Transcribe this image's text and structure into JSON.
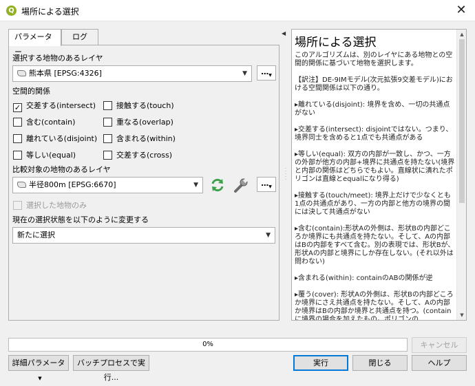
{
  "window": {
    "title": "場所による選択",
    "close_glyph": "✕",
    "app_icon_letter": "Q"
  },
  "tabs": [
    {
      "label": "パラメーター",
      "active": true
    },
    {
      "label": "ログ",
      "active": false
    }
  ],
  "form": {
    "source_label": "選択する地物のあるレイヤ",
    "source_value": "熊本県 [EPSG:4326]",
    "predicate_label": "空間的関係",
    "predicates": [
      {
        "label": "交差する(intersect)",
        "checked": true
      },
      {
        "label": "接触する(touch)",
        "checked": false
      },
      {
        "label": "含む(contain)",
        "checked": false
      },
      {
        "label": "重なる(overlap)",
        "checked": false
      },
      {
        "label": "離れている(disjoint)",
        "checked": false
      },
      {
        "label": "含まれる(within)",
        "checked": false
      },
      {
        "label": "等しい(equal)",
        "checked": false
      },
      {
        "label": "交差する(cross)",
        "checked": false
      }
    ],
    "compare_label": "比較対象の地物のあるレイヤ",
    "compare_value": "半径800m [EPSG:6670]",
    "selected_only_label": "選択した地物のみ",
    "selected_only_checked": false,
    "method_label": "現在の選択状態を以下のように変更する",
    "method_value": "新たに選択",
    "dots_label": "…"
  },
  "help": {
    "title": "場所による選択",
    "paragraphs": [
      "このアルゴリズムは、別のレイヤにある地物との空間的関係に基づいて地物を選択します。",
      "【訳注】DE-9IMモデル(次元拡張9交差モデル)における空間関係は以下の通り。",
      "▸離れている(disjoint): 境界を含め、一切の共通点がない",
      "▸交差する(intersect): disjointではない。つまり、境界同士を含めると1点でも共通点がある",
      "▸等しい(equal): 双方の内部が一致し、かつ、一方の外部が他方の内部+境界に共通点を持たない(境界と内部の関係はどちらでもよい。直線状に潰れたポリゴンは直線とequalになり得る)",
      "▸接触する(touch/meet): 境界上だけで少なくとも1点の共通点があり、一方の内部と他方の境界の間には決して共通点がない",
      "▸含む(contain):形状Aの外側は、形状Bの内部どころか境界にも共通点を持たない。そして、Aの内部はBの内部をすべて含む。別の表現では、形状Bが、形状Aの内部と境界にしか存在しない。(それ以外は問わない)",
      "▸含まれる(within): containのABの関係が逆",
      "▸覆う(cover): 形状Aの外側は、形状Bの内部どころか境界にさえ共通点を持たない。そして、Aの内部か境界はBの内部か境界と共通点を持つ。(containに境界の場合を加えたもの。ポリゴンの"
    ]
  },
  "progress": {
    "value": 0,
    "text": "0%",
    "color": "#06b025"
  },
  "buttons": {
    "cancel": "キャンセル",
    "advanced": "詳細パラメータ",
    "batch": "バッチプロセスで実行...",
    "run": "実行",
    "close": "閉じる",
    "help": "ヘルプ"
  },
  "colors": {
    "accent": "#0078d7",
    "qgis_green": "#93b023",
    "refresh_green": "#3da14a"
  }
}
